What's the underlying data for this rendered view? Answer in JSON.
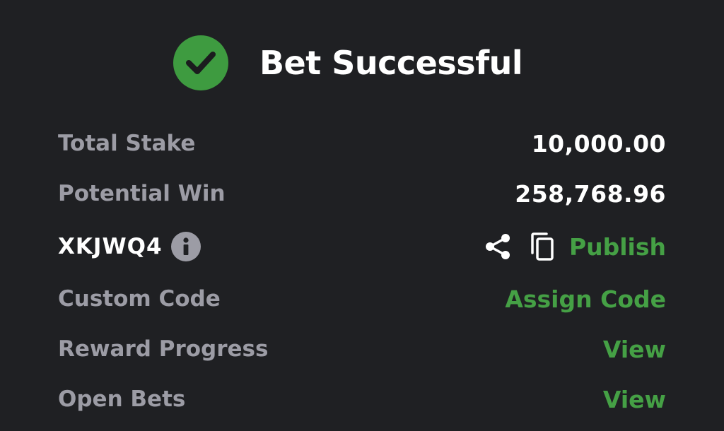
{
  "header": {
    "title": "Bet Successful",
    "status_icon": "check-circle-icon",
    "accent_color": "#3e9b40"
  },
  "summary": {
    "total_stake_label": "Total Stake",
    "total_stake_value": "10,000.00",
    "potential_win_label": "Potential Win",
    "potential_win_value": "258,768.96"
  },
  "booking": {
    "code": "XKJWQ4",
    "info_icon": "info-icon",
    "share_icon": "share-icon",
    "copy_icon": "copy-icon",
    "publish_label": "Publish"
  },
  "links": {
    "custom_code_label": "Custom Code",
    "custom_code_action": "Assign Code",
    "reward_progress_label": "Reward Progress",
    "reward_progress_action": "View",
    "open_bets_label": "Open Bets",
    "open_bets_action": "View"
  },
  "colors": {
    "background": "#1f2023",
    "label": "#9c9ca5",
    "value": "#ffffff",
    "link": "#45a045"
  }
}
